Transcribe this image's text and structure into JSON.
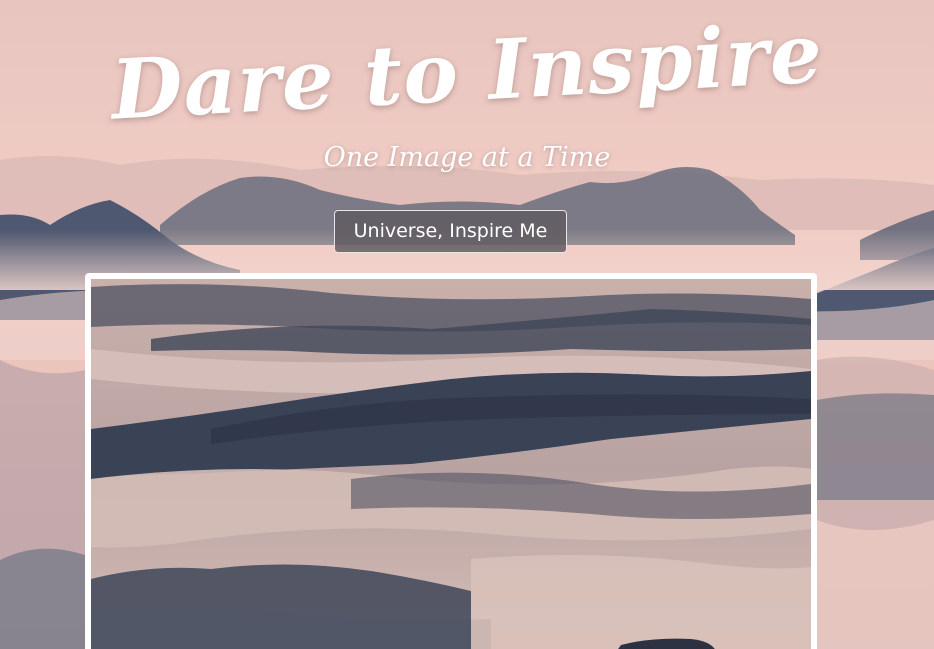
{
  "header": {
    "title": "Dare to Inspire",
    "subtitle": "One Image at a Time"
  },
  "actions": {
    "inspire_button_label": "Universe, Inspire Me"
  },
  "colors": {
    "sky_top": "#e9c7c0",
    "sky_bottom": "#f0c6bc",
    "mountain": "#5d6273",
    "button_bg": "#605a60",
    "frame_border": "#ffffff",
    "text": "#ffffff"
  }
}
